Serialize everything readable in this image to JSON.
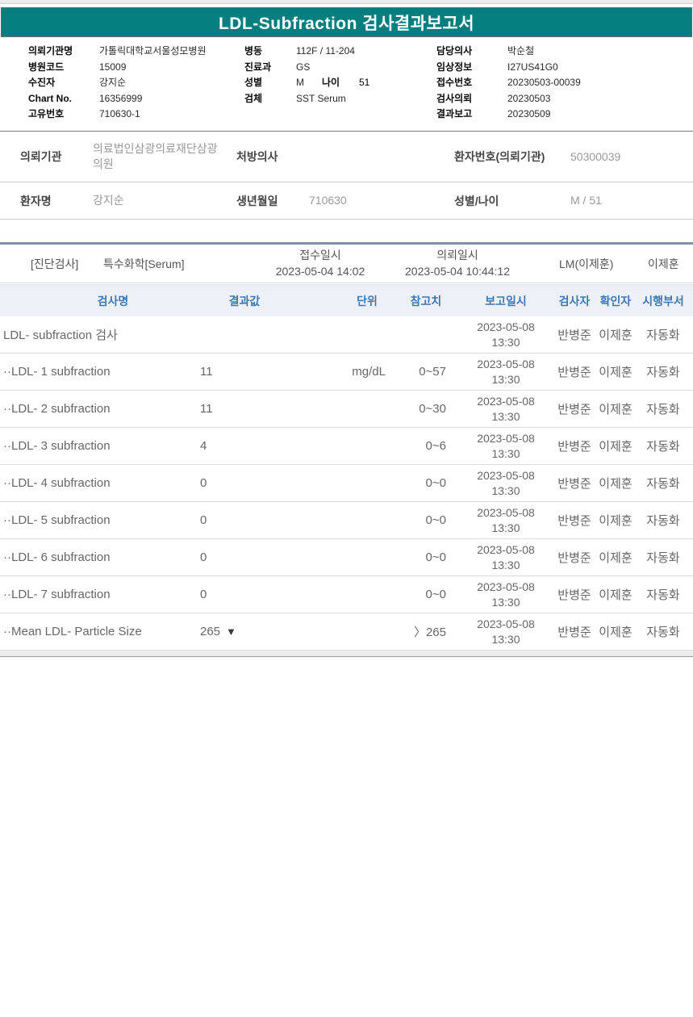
{
  "report": {
    "title": "LDL-Subfraction 검사결과보고서"
  },
  "colors": {
    "titlebar_teal": "#047e7e",
    "table_header_blue": "#3d77b5",
    "accent_line_bluegray": "#7b94ae",
    "value_gray": "#999999"
  },
  "patient_header": {
    "groups": [
      {
        "rows": [
          {
            "label": "의뢰기관명",
            "value": "가톨릭대학교서울성모병원"
          },
          {
            "label": "병원코드",
            "value": "15009"
          },
          {
            "label": "수진자",
            "value": "강지순"
          },
          {
            "label": "Chart No.",
            "value": "16356999"
          },
          {
            "label": "고유번호",
            "value": "710630-1"
          }
        ]
      },
      {
        "rows": [
          {
            "label": "병동",
            "value": "112F / 11-204"
          },
          {
            "label": "진료과",
            "value": "GS"
          },
          {
            "label": "성별",
            "value": "M",
            "label2": "나이",
            "value2": "51"
          },
          {
            "label": "검체",
            "value": "SST Serum"
          }
        ]
      },
      {
        "rows": [
          {
            "label": "담당의사",
            "value": "박순철"
          },
          {
            "label": "임상정보",
            "value": "I27US41G0"
          },
          {
            "label": "접수번호",
            "value": "20230503-00039"
          },
          {
            "label": "검사의뢰",
            "value": "20230503"
          },
          {
            "label": "결과보고",
            "value": "20230509"
          }
        ]
      }
    ]
  },
  "referral": {
    "rows": [
      {
        "cells": [
          {
            "label": "의뢰기관",
            "value": "의료법인삼광의료재단삼광의원"
          },
          {
            "label": "처방의사",
            "value": ""
          },
          {
            "label": "환자번호(의뢰기관)",
            "value": "50300039"
          }
        ]
      },
      {
        "cells": [
          {
            "label": "환자명",
            "value": "강지순"
          },
          {
            "label": "생년월일",
            "value": "710630"
          },
          {
            "label": "성별/나이",
            "value": "M / 51"
          }
        ]
      }
    ]
  },
  "order_bar": {
    "category": "[진단검사]",
    "test_group": "특수화학[Serum]",
    "received_label": "접수일시",
    "received_value": "2023-05-04 14:02",
    "requested_label": "의뢰일시",
    "requested_value": "2023-05-04 10:44:12",
    "lm": "LM(이제훈)",
    "confirmer": "이제훈"
  },
  "table": {
    "columns": [
      "검사명",
      "결과값",
      "단위",
      "참고치",
      "보고일시",
      "검사자",
      "확인자",
      "시행부서"
    ],
    "rows": [
      {
        "name": "LDL- subfraction 검사",
        "result": "",
        "flag": "",
        "unit": "",
        "ref": "",
        "date": "2023-05-08",
        "time": "13:30",
        "tester": "반병준",
        "confirmer": "이제훈",
        "dept": "자동화"
      },
      {
        "name": "··LDL- 1 subfraction",
        "result": "11",
        "flag": "",
        "unit": "mg/dL",
        "ref": "0~57",
        "date": "2023-05-08",
        "time": "13:30",
        "tester": "반병준",
        "confirmer": "이제훈",
        "dept": "자동화"
      },
      {
        "name": "··LDL- 2 subfraction",
        "result": "11",
        "flag": "",
        "unit": "",
        "ref": "0~30",
        "date": "2023-05-08",
        "time": "13:30",
        "tester": "반병준",
        "confirmer": "이제훈",
        "dept": "자동화"
      },
      {
        "name": "··LDL- 3 subfraction",
        "result": "4",
        "flag": "",
        "unit": "",
        "ref": "0~6",
        "date": "2023-05-08",
        "time": "13:30",
        "tester": "반병준",
        "confirmer": "이제훈",
        "dept": "자동화"
      },
      {
        "name": "··LDL- 4 subfraction",
        "result": "0",
        "flag": "",
        "unit": "",
        "ref": "0~0",
        "date": "2023-05-08",
        "time": "13:30",
        "tester": "반병준",
        "confirmer": "이제훈",
        "dept": "자동화"
      },
      {
        "name": "··LDL- 5 subfraction",
        "result": "0",
        "flag": "",
        "unit": "",
        "ref": "0~0",
        "date": "2023-05-08",
        "time": "13:30",
        "tester": "반병준",
        "confirmer": "이제훈",
        "dept": "자동화"
      },
      {
        "name": "··LDL- 6 subfraction",
        "result": "0",
        "flag": "",
        "unit": "",
        "ref": "0~0",
        "date": "2023-05-08",
        "time": "13:30",
        "tester": "반병준",
        "confirmer": "이제훈",
        "dept": "자동화"
      },
      {
        "name": "··LDL- 7 subfraction",
        "result": "0",
        "flag": "",
        "unit": "",
        "ref": "0~0",
        "date": "2023-05-08",
        "time": "13:30",
        "tester": "반병준",
        "confirmer": "이제훈",
        "dept": "자동화"
      },
      {
        "name": "··Mean LDL- Particle Size",
        "result": "265",
        "flag": "▼",
        "unit": "",
        "ref": "〉265",
        "date": "2023-05-08",
        "time": "13:30",
        "tester": "반병준",
        "confirmer": "이제훈",
        "dept": "자동화"
      }
    ]
  }
}
